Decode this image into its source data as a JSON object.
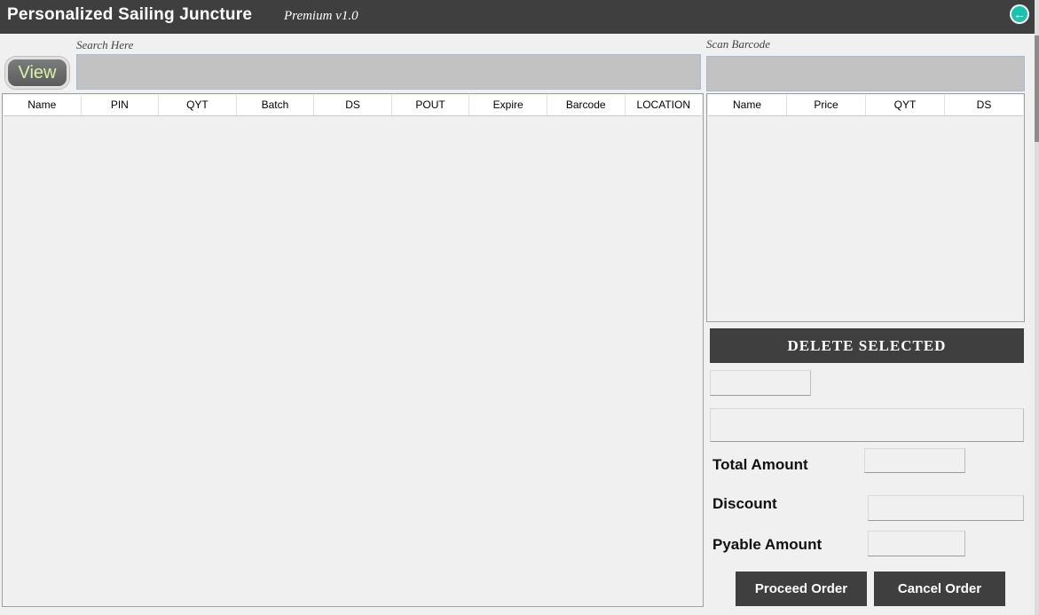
{
  "app": {
    "title": "Personalized Sailing Juncture",
    "version": "Premium v1.0"
  },
  "search": {
    "label": "Search Here",
    "view_button": "View",
    "value": ""
  },
  "barcode": {
    "label": "Scan Barcode",
    "value": ""
  },
  "inventory_table": {
    "columns": [
      "Name",
      "PIN",
      "QYT",
      "Batch",
      "DS",
      "POUT",
      "Expire",
      "Barcode",
      "LOCATION"
    ],
    "rows": []
  },
  "cart_table": {
    "columns": [
      "Name",
      "Price",
      "QYT",
      "DS"
    ],
    "rows": []
  },
  "actions": {
    "delete_selected": "DELETE SELECTED",
    "proceed": "Proceed Order",
    "cancel": "Cancel Order"
  },
  "summary": {
    "total_label": "Total Amount",
    "discount_label": "Discount",
    "payable_label": "Pyable Amount",
    "total_value": "",
    "discount_value": "",
    "payable_value": ""
  },
  "colors": {
    "titlebar": "#3f3f3f",
    "accent": "#18c4b0",
    "input_bg": "#c2c2c2"
  }
}
